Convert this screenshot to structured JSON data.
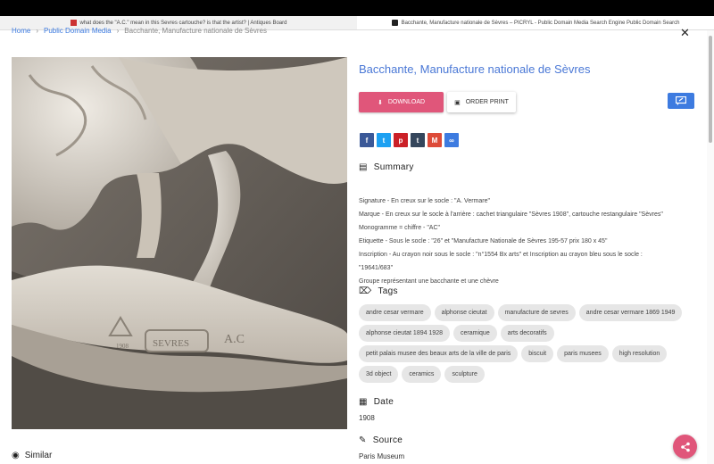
{
  "browser": {
    "tabs": [
      {
        "label": "what does the \"A.C.\" mean in this Sevres cartouche? is that the artist? | Antiques Board",
        "active": false
      },
      {
        "label": "Bacchante, Manufacture nationale de Sèvres – PICRYL - Public Domain Media Search Engine Public Domain Search",
        "active": true
      }
    ]
  },
  "breadcrumb": {
    "home": "Home",
    "category": "Public Domain Media",
    "current": "Bacchante, Manufacture nationale de Sèvres"
  },
  "item": {
    "title": "Bacchante, Manufacture nationale de Sèvres",
    "download_label": "DOWNLOAD",
    "order_label": "ORDER PRINT"
  },
  "share_buttons": [
    {
      "name": "facebook",
      "glyph": "f",
      "color": "#3b5998"
    },
    {
      "name": "twitter",
      "glyph": "t",
      "color": "#1da1f2"
    },
    {
      "name": "pinterest",
      "glyph": "p",
      "color": "#cb2027"
    },
    {
      "name": "tumblr",
      "glyph": "t",
      "color": "#35465c"
    },
    {
      "name": "gmail",
      "glyph": "M",
      "color": "#dd4b39"
    },
    {
      "name": "link",
      "glyph": "∞",
      "color": "#3d7be0"
    }
  ],
  "summary": {
    "heading": "Summary",
    "lines": [
      "Signature - En creux sur le socle : \"A. Vermare\"",
      "Marque - En creux sur le socle à l'arrière : cachet triangulaire \"Sèvres 1908\", cartouche restangulaire \"Sèvres\"",
      "Monogramme = chiffre - \"AC\"",
      "Etiquette - Sous le socle : \"26\" et \"Manufacture Nationale de Sèvres 195-57 prix 180 x 45\"",
      "Inscription - Au crayon noir sous le socle : \"n°1554 Bx arts\" et Inscription au crayon bleu sous le socle :",
      "\"19641/683\"",
      "Groupe représentant une bacchante et une chèvre"
    ]
  },
  "tags": {
    "heading": "Tags",
    "items": [
      "andre cesar vermare",
      "alphonse cieutat",
      "manufacture de sevres",
      "andre cesar vermare 1869 1949",
      "alphonse cieutat 1894 1928",
      "ceramique",
      "arts decoratifs",
      "petit palais musee des beaux arts de la ville de paris",
      "biscuit",
      "paris musees",
      "high resolution",
      "3d object",
      "ceramics",
      "sculpture"
    ]
  },
  "date": {
    "heading": "Date",
    "value": "1908"
  },
  "source": {
    "heading": "Source",
    "value": "Paris Museum"
  },
  "similar": {
    "heading": "Similar"
  },
  "photo": {
    "mark_sevres": "SEVRES",
    "mark_ac": "A.C",
    "mark_year": "1908"
  }
}
